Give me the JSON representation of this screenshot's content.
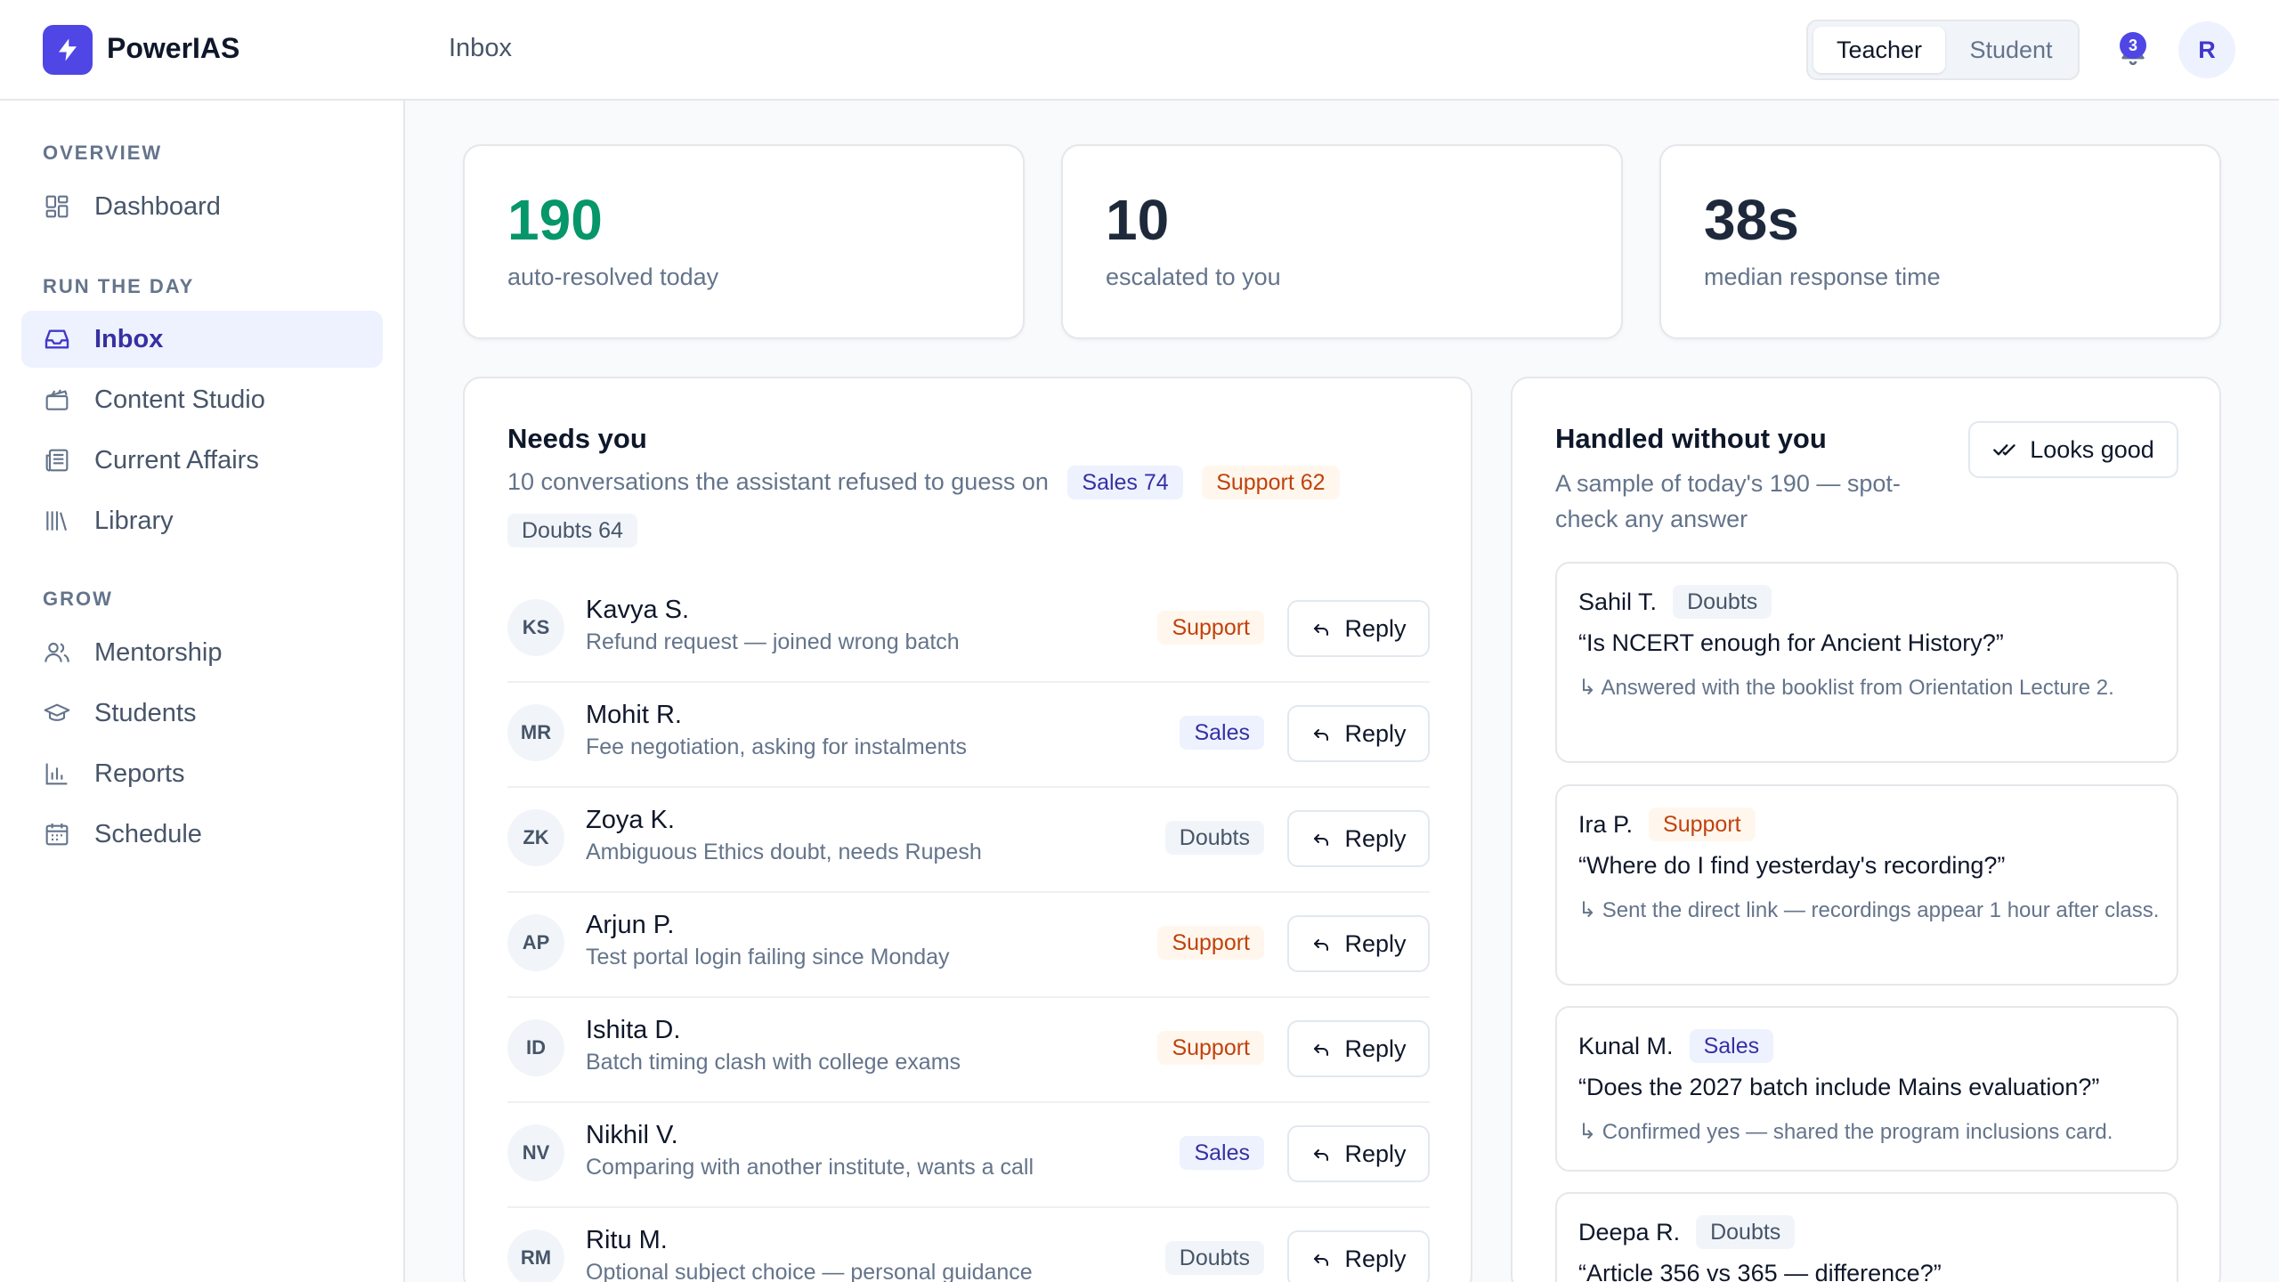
{
  "brand": {
    "name": "PowerIAS",
    "logo_icon": "bolt-icon",
    "accent": "#4f46e5"
  },
  "header": {
    "breadcrumb": "Inbox",
    "roles": [
      "Teacher",
      "Student"
    ],
    "active_role": "Teacher",
    "notification_count": "3",
    "avatar_initial": "R"
  },
  "sidebar": {
    "sections": [
      {
        "label": "OVERVIEW",
        "items": [
          {
            "label": "Dashboard",
            "icon": "dashboard-icon"
          }
        ]
      },
      {
        "label": "RUN THE DAY",
        "items": [
          {
            "label": "Inbox",
            "icon": "inbox-icon",
            "active": true
          },
          {
            "label": "Content Studio",
            "icon": "clapperboard-icon"
          },
          {
            "label": "Current Affairs",
            "icon": "newspaper-icon"
          },
          {
            "label": "Library",
            "icon": "library-icon"
          }
        ]
      },
      {
        "label": "GROW",
        "items": [
          {
            "label": "Mentorship",
            "icon": "users-icon"
          },
          {
            "label": "Students",
            "icon": "graduation-cap-icon"
          },
          {
            "label": "Reports",
            "icon": "bar-chart-icon"
          },
          {
            "label": "Schedule",
            "icon": "calendar-icon"
          }
        ]
      }
    ]
  },
  "stats": [
    {
      "value": "190",
      "label": "auto-resolved today",
      "color": "#059669"
    },
    {
      "value": "10",
      "label": "escalated to you",
      "color": "#1e293b"
    },
    {
      "value": "38s",
      "label": "median response time",
      "color": "#1e293b"
    }
  ],
  "needs_you": {
    "title": "Needs you",
    "subtitle": "10 conversations the assistant refused to guess on",
    "counts": [
      {
        "label": "Sales 74",
        "kind": "sales"
      },
      {
        "label": "Support 62",
        "kind": "support"
      },
      {
        "label": "Doubts 64",
        "kind": "doubts"
      }
    ],
    "reply_label": "Reply",
    "rows": [
      {
        "initials": "KS",
        "name": "Kavya S.",
        "desc": "Refund request — joined wrong batch",
        "tag": "Support"
      },
      {
        "initials": "MR",
        "name": "Mohit R.",
        "desc": "Fee negotiation, asking for instalments",
        "tag": "Sales"
      },
      {
        "initials": "ZK",
        "name": "Zoya K.",
        "desc": "Ambiguous Ethics doubt, needs Rupesh",
        "tag": "Doubts"
      },
      {
        "initials": "AP",
        "name": "Arjun P.",
        "desc": "Test portal login failing since Monday",
        "tag": "Support"
      },
      {
        "initials": "ID",
        "name": "Ishita D.",
        "desc": "Batch timing clash with college exams",
        "tag": "Support"
      },
      {
        "initials": "NV",
        "name": "Nikhil V.",
        "desc": "Comparing with another institute, wants a call",
        "tag": "Sales"
      },
      {
        "initials": "RM",
        "name": "Ritu M.",
        "desc": "Optional subject choice — personal guidance",
        "tag": "Doubts"
      }
    ]
  },
  "handled": {
    "title": "Handled without you",
    "subtitle_line1": "A sample of today's 190 — spot-",
    "subtitle_line2": "check any answer",
    "button_label": "Looks good",
    "cards": [
      {
        "name": "Sahil T.",
        "tag": "Doubts",
        "question": "“Is NCERT enough for Ancient History?”",
        "answer": "↳ Answered with the booklist from Orientation Lecture 2."
      },
      {
        "name": "Ira P.",
        "tag": "Support",
        "question": "“Where do I find yesterday's recording?”",
        "answer": "↳ Sent the direct link — recordings appear 1 hour after class."
      },
      {
        "name": "Kunal M.",
        "tag": "Sales",
        "question": "“Does the 2027 batch include Mains evaluation?”",
        "answer": "↳ Confirmed yes — shared the program inclusions card."
      },
      {
        "name": "Deepa R.",
        "tag": "Doubts",
        "question": "“Article 356 vs 365 — difference?”",
        "answer": ""
      }
    ]
  }
}
